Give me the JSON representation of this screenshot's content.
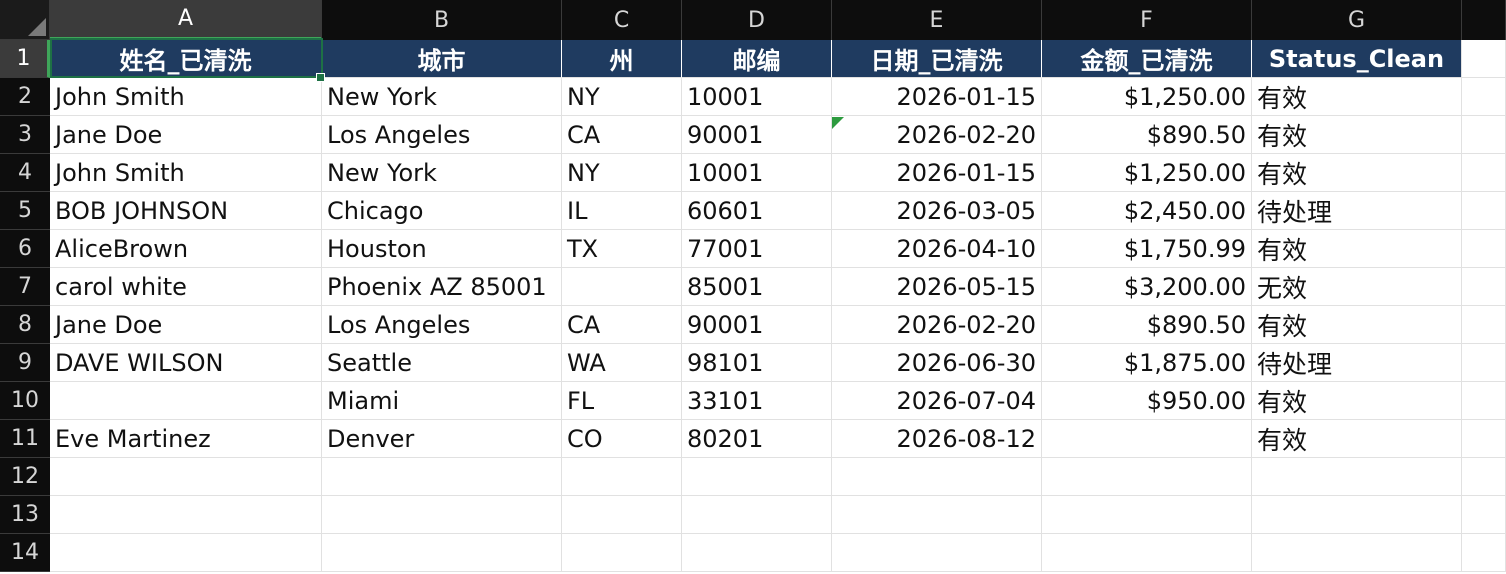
{
  "sheet": {
    "columns": [
      "A",
      "B",
      "C",
      "D",
      "E",
      "F",
      "G"
    ],
    "rows": [
      "1",
      "2",
      "3",
      "4",
      "5",
      "6",
      "7",
      "8",
      "9",
      "10",
      "11",
      "12",
      "13",
      "14"
    ],
    "selected_column": "A",
    "selected_row": "1"
  },
  "table": {
    "headers": [
      "姓名_已清洗",
      "城市",
      "州",
      "邮编",
      "日期_已清洗",
      "金额_已清洗",
      "Status_Clean"
    ],
    "rows": [
      [
        "John Smith",
        "New York",
        "NY",
        "10001",
        "2026-01-15",
        "$1,250.00",
        "有效"
      ],
      [
        "Jane Doe",
        "Los Angeles",
        "CA",
        "90001",
        "2026-02-20",
        "$890.50",
        "有效"
      ],
      [
        "John Smith",
        "New York",
        "NY",
        "10001",
        "2026-01-15",
        "$1,250.00",
        "有效"
      ],
      [
        "BOB JOHNSON",
        "Chicago",
        "IL",
        "60601",
        "2026-03-05",
        "$2,450.00",
        "待处理"
      ],
      [
        "AliceBrown",
        "Houston",
        "TX",
        "77001",
        "2026-04-10",
        "$1,750.99",
        "有效"
      ],
      [
        "carol white",
        "Phoenix AZ 85001",
        "",
        "85001",
        "2026-05-15",
        "$3,200.00",
        "无效"
      ],
      [
        "Jane Doe",
        "Los Angeles",
        "CA",
        "90001",
        "2026-02-20",
        "$890.50",
        "有效"
      ],
      [
        "DAVE WILSON",
        "Seattle",
        "WA",
        "98101",
        "2026-06-30",
        "$1,875.00",
        "待处理"
      ],
      [
        "",
        "Miami",
        "FL",
        "33101",
        "2026-07-04",
        "$950.00",
        "有效"
      ],
      [
        "Eve Martinez",
        "Denver",
        "CO",
        "80201",
        "2026-08-12",
        "",
        "有效"
      ]
    ]
  },
  "colors": {
    "header_fill": "#1f3b60",
    "selection_border": "#1e7145",
    "sheet_header_bg": "#0d0d0d"
  }
}
